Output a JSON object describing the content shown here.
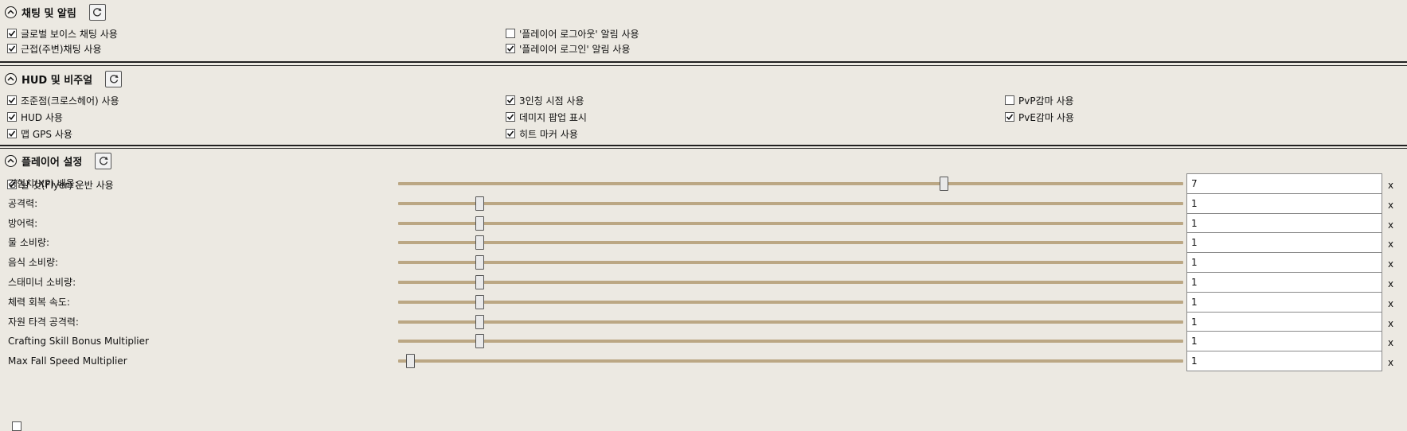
{
  "chat_section": {
    "title": "채팅 및 알림",
    "checkboxes": [
      {
        "label": "글로벌 보이스 채팅 사용",
        "checked": true
      },
      {
        "label": "근접(주변)채팅 사용",
        "checked": true
      },
      {
        "label": "'플레이어 로그아웃' 알림 사용",
        "checked": false
      },
      {
        "label": "'플레이어 로그인' 알림 사용",
        "checked": true
      }
    ]
  },
  "hud_section": {
    "title": "HUD 및 비주얼",
    "checkboxes": [
      {
        "label": "조준점(크로스헤어) 사용",
        "checked": true
      },
      {
        "label": "HUD 사용",
        "checked": true
      },
      {
        "label": "맵 GPS 사용",
        "checked": true
      },
      {
        "label": "3인칭 시점 사용",
        "checked": true
      },
      {
        "label": "데미지 팝업 표시",
        "checked": true
      },
      {
        "label": "히트 마커 사용",
        "checked": true
      },
      {
        "label": "PvP감마 사용",
        "checked": false
      },
      {
        "label": "PvE감마 사용",
        "checked": true
      }
    ]
  },
  "player_section": {
    "title": "플레이어 설정",
    "flyer_checkbox": {
      "label": "날 것(Flyer) 운반 사용",
      "checked": true
    },
    "unit_label": "x",
    "sliders": [
      {
        "label": "경험치(XP) 배율:",
        "value": "7",
        "level": 0.695
      },
      {
        "label": "공격력:",
        "value": "1",
        "level": 0.103
      },
      {
        "label": "방어력:",
        "value": "1",
        "level": 0.103
      },
      {
        "label": "물 소비량:",
        "value": "1",
        "level": 0.103
      },
      {
        "label": "음식 소비량:",
        "value": "1",
        "level": 0.103
      },
      {
        "label": "스태미너 소비량:",
        "value": "1",
        "level": 0.103
      },
      {
        "label": "체력 회복 속도:",
        "value": "1",
        "level": 0.103
      },
      {
        "label": "자원 타격 공격력:",
        "value": "1",
        "level": 0.103
      },
      {
        "label": "Crafting Skill Bonus Multiplier",
        "value": "1",
        "level": 0.103
      },
      {
        "label": "Max Fall Speed Multiplier",
        "value": "1",
        "level": 0.015
      }
    ]
  },
  "icons": {
    "collapse": "chevron-up-circle-icon",
    "refresh": "refresh-icon",
    "check": "checkmark-icon"
  },
  "colors": {
    "background": "#ece9e2",
    "slider_track": "#bba784",
    "section_border": "#222222"
  }
}
